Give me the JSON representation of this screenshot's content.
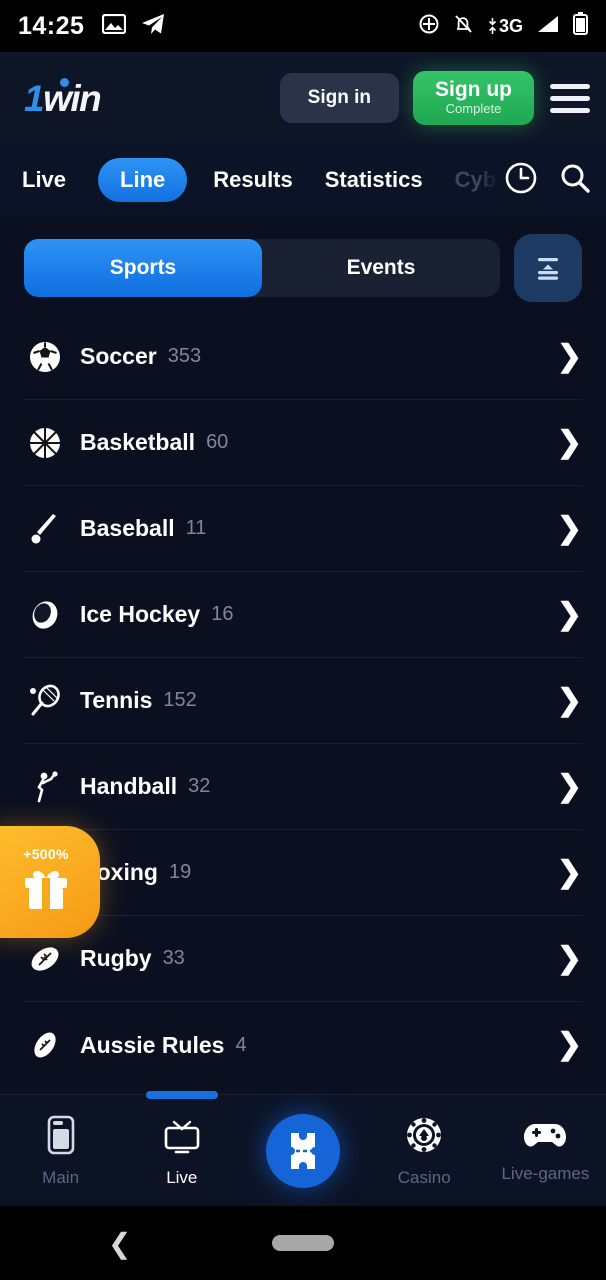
{
  "status_bar": {
    "time": "14:25",
    "left_icons": [
      "image-icon",
      "telegram-send-icon"
    ],
    "right_icons": [
      "location-target-icon",
      "notifications-muted-icon",
      "signal-bars-icon",
      "battery-icon"
    ],
    "network": "3G"
  },
  "header": {
    "logo_one": "1",
    "logo_win": "win",
    "sign_in_label": "Sign in",
    "sign_up_label": "Sign up",
    "sign_up_sublabel": "Complete",
    "menu_icon": "hamburger-menu-icon"
  },
  "nav_tabs": {
    "items": [
      {
        "label": "Live",
        "active": false,
        "dim": false
      },
      {
        "label": "Line",
        "active": true,
        "dim": false
      },
      {
        "label": "Results",
        "active": false,
        "dim": false
      },
      {
        "label": "Statistics",
        "active": false,
        "dim": false
      },
      {
        "label": "Cyb",
        "active": false,
        "dim": true
      }
    ],
    "clock_icon": "clock-icon",
    "search_icon": "search-icon"
  },
  "segment": {
    "sports_label": "Sports",
    "events_label": "Events",
    "active": "Sports",
    "filter_icon": "sort-filter-icon"
  },
  "sports": [
    {
      "name": "Soccer",
      "count": "353",
      "icon": "soccer-ball-icon"
    },
    {
      "name": "Basketball",
      "count": "60",
      "icon": "basketball-icon"
    },
    {
      "name": "Baseball",
      "count": "11",
      "icon": "baseball-bat-icon"
    },
    {
      "name": "Ice Hockey",
      "count": "16",
      "icon": "hockey-puck-icon"
    },
    {
      "name": "Tennis",
      "count": "152",
      "icon": "tennis-racket-icon"
    },
    {
      "name": "Handball",
      "count": "32",
      "icon": "handball-player-icon"
    },
    {
      "name": "Boxing",
      "count": "19",
      "icon": "boxing-glove-icon"
    },
    {
      "name": "Rugby",
      "count": "33",
      "icon": "rugby-ball-icon"
    },
    {
      "name": "Aussie Rules",
      "count": "4",
      "icon": "aussie-rules-ball-icon"
    }
  ],
  "promo": {
    "bonus_text": "+500%",
    "icon": "gift-box-icon"
  },
  "bottom_nav": {
    "items": [
      {
        "label": "Main",
        "icon": "main-phone-icon",
        "active": false
      },
      {
        "label": "Live",
        "icon": "tv-icon",
        "active": true
      },
      {
        "label": "Casino",
        "icon": "poker-chip-icon",
        "active": false
      },
      {
        "label": "Live-games",
        "icon": "gamepad-icon",
        "active": false
      }
    ],
    "center_icon": "betslip-ticket-icon"
  },
  "system_nav": {
    "back_icon": "back-chevron-icon",
    "home_icon": "home-pill-icon"
  },
  "colors": {
    "accent_blue": "#1a7ae8",
    "green": "#2eb85c",
    "promo_orange": "#f5a623",
    "background": "#0b1020",
    "surface": "#0e1527"
  }
}
